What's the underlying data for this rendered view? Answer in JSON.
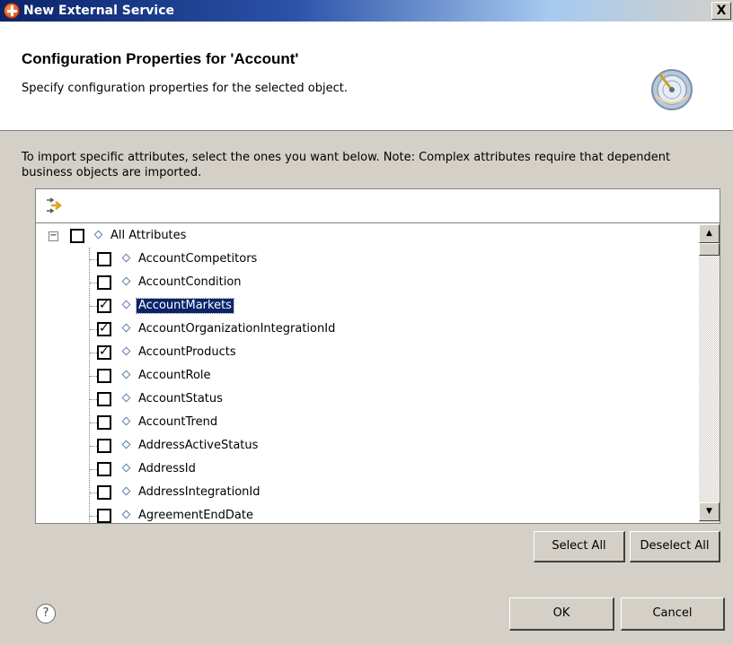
{
  "window": {
    "title": "New External Service",
    "close_glyph": "X"
  },
  "header": {
    "title": "Configuration Properties for 'Account'",
    "description": "Specify configuration properties for the selected object."
  },
  "instructions": "To import specific attributes, select the ones you want below. Note: Complex attributes require that dependent business objects are imported.",
  "tree": {
    "root": {
      "label": "All Attributes",
      "checked": false,
      "expanded": true
    },
    "items": [
      {
        "label": "AccountCompetitors",
        "checked": false,
        "selected": false
      },
      {
        "label": "AccountCondition",
        "checked": false,
        "selected": false
      },
      {
        "label": "AccountMarkets",
        "checked": true,
        "selected": true
      },
      {
        "label": "AccountOrganizationIntegrationId",
        "checked": true,
        "selected": false
      },
      {
        "label": "AccountProducts",
        "checked": true,
        "selected": false
      },
      {
        "label": "AccountRole",
        "checked": false,
        "selected": false
      },
      {
        "label": "AccountStatus",
        "checked": false,
        "selected": false
      },
      {
        "label": "AccountTrend",
        "checked": false,
        "selected": false
      },
      {
        "label": "AddressActiveStatus",
        "checked": false,
        "selected": false
      },
      {
        "label": "AddressId",
        "checked": false,
        "selected": false
      },
      {
        "label": "AddressIntegrationId",
        "checked": false,
        "selected": false
      },
      {
        "label": "AgreementEndDate",
        "checked": false,
        "selected": false
      }
    ]
  },
  "buttons": {
    "select_all": "Select All",
    "deselect_all": "Deselect All",
    "ok": "OK",
    "cancel": "Cancel",
    "help": "?"
  },
  "icons": {
    "app": "eclipse-app-icon",
    "wizard": "gauge-wizard-icon",
    "toolbar": "expand-tree-icon",
    "help": "help-icon"
  },
  "colors": {
    "titlebar_start": "#0a246a",
    "selection": "#0a246a",
    "dialog_bg": "#d4d0c8"
  }
}
